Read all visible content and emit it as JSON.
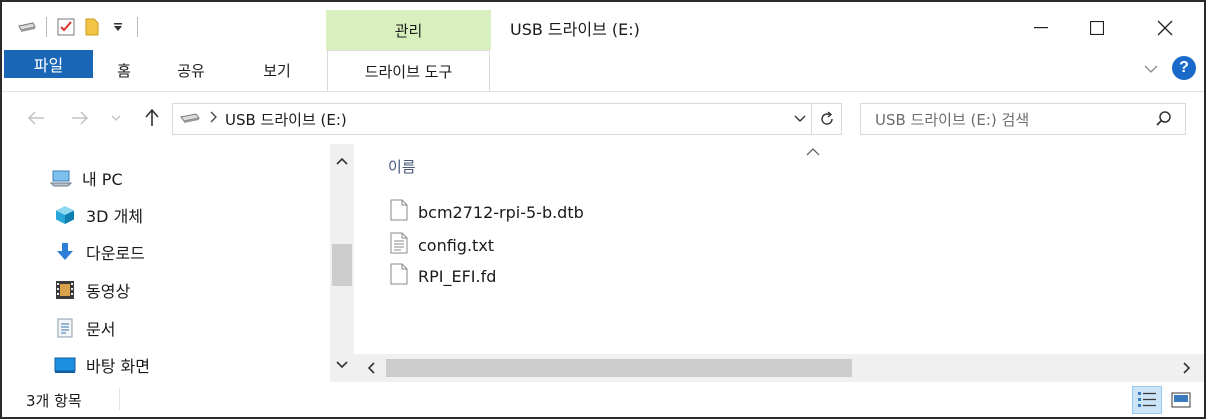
{
  "window": {
    "title": "USB 드라이브 (E:)",
    "contextual_tab_group": "관리",
    "controls": {
      "minimize": "—",
      "maximize": "☐",
      "close": "✕"
    }
  },
  "ribbon": {
    "tabs": [
      {
        "label": "파일"
      },
      {
        "label": "홈"
      },
      {
        "label": "공유"
      },
      {
        "label": "보기"
      },
      {
        "label": "드라이브 도구"
      }
    ]
  },
  "navigation": {
    "address_path": "USB 드라이브 (E:)",
    "search_placeholder": "USB 드라이브 (E:) 검색"
  },
  "sidebar": {
    "items": [
      {
        "label": "내 PC",
        "icon": "pc-icon"
      },
      {
        "label": "3D 개체",
        "icon": "cube-icon"
      },
      {
        "label": "다운로드",
        "icon": "download-arrow-icon"
      },
      {
        "label": "동영상",
        "icon": "film-icon"
      },
      {
        "label": "문서",
        "icon": "document-icon"
      },
      {
        "label": "바탕 화면",
        "icon": "desktop-icon"
      }
    ]
  },
  "content": {
    "column_header": "이름",
    "files": [
      {
        "name": "bcm2712-rpi-5-b.dtb",
        "icon": "file-icon"
      },
      {
        "name": "config.txt",
        "icon": "text-file-icon"
      },
      {
        "name": "RPI_EFI.fd",
        "icon": "file-icon"
      }
    ]
  },
  "status": {
    "item_count": "3개 항목"
  },
  "colors": {
    "file_tab": "#1966b6",
    "manage_tab": "#d7f0be",
    "help": "#1a6bc9",
    "column_header": "#4a5b80"
  }
}
